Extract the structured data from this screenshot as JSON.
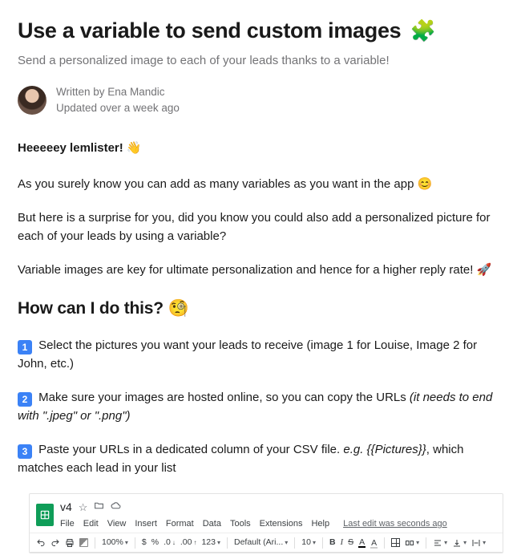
{
  "title": "Use a variable to send custom images",
  "title_emoji": "🧩",
  "subtitle": "Send a personalized image to each of your leads thanks to a variable!",
  "author": {
    "written_by": "Written by Ena Mandic",
    "updated": "Updated over a week ago"
  },
  "body": {
    "greeting": "Heeeeey lemlister!",
    "greeting_emoji": "👋",
    "p1": "As you surely know you can add as many variables as you want in the app",
    "p1_emoji": "😊",
    "p2": "But here is a surprise for you, did you know you could also add a personalized picture for each of your leads by using a variable?",
    "p3_a": "Variable images are key for ultimate personalization and hence for a higher reply rate!",
    "p3_emoji": "🚀",
    "h2": "How can I do this?",
    "h2_emoji": "🧐",
    "step1": "Select the pictures you want your leads to receive (image 1 for Louise, Image 2 for John, etc.)",
    "step2_a": "Make sure your images are hosted online, so you can copy the URLs ",
    "step2_b": "(it needs to end with \".jpeg\" or \".png\")",
    "step3_a": "Paste your URLs in a dedicated column of your CSV file. ",
    "step3_b": "e.g. {{Pictures}}",
    "step3_c": ", which matches each lead in your list",
    "num1": "1",
    "num2": "2",
    "num3": "3"
  },
  "sheet": {
    "filename": "v4",
    "menu": [
      "File",
      "Edit",
      "View",
      "Insert",
      "Format",
      "Data",
      "Tools",
      "Extensions",
      "Help"
    ],
    "lastedit": "Last edit was seconds ago",
    "toolbar": {
      "zoom": "100%",
      "currency": "$",
      "percent": "%",
      "dec_dec": ".0",
      "dec_inc": ".00",
      "numfmt": "123",
      "font": "Default (Ari...",
      "fontsize": "10"
    }
  }
}
